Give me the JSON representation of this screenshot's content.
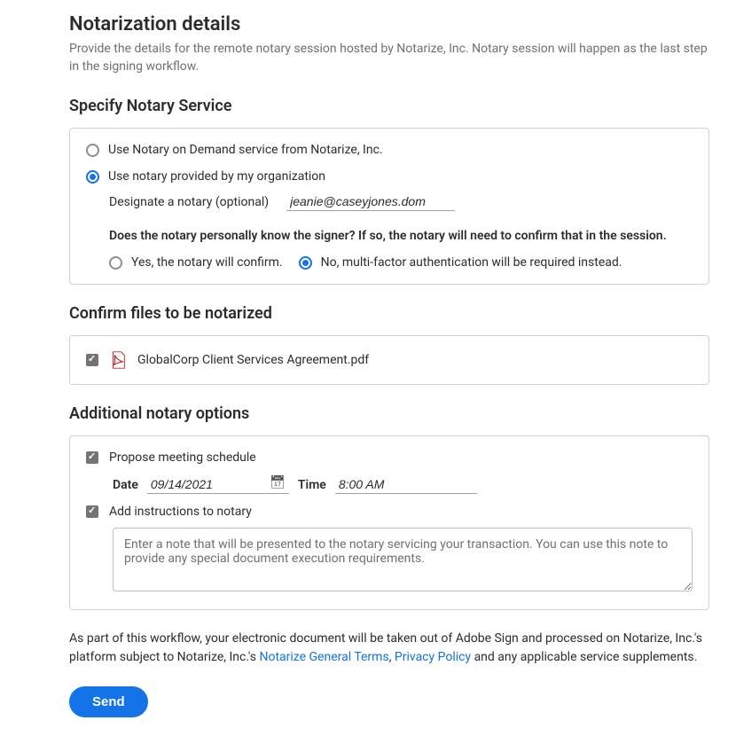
{
  "header": {
    "title": "Notarization details",
    "subtitle": "Provide the details for the remote notary session hosted by Notarize, Inc. Notary session will happen as the last step in the signing workflow."
  },
  "notaryService": {
    "heading": "Specify Notary Service",
    "option1": "Use Notary on Demand service from Notarize, Inc.",
    "option2": "Use notary provided by my organization",
    "designateLabel": "Designate a notary (optional)",
    "designateValue": "jeanie@caseyjones.dom",
    "knowQuestion": "Does the notary personally know the signer? If so, the notary will need to confirm that in the session.",
    "yesLabel": "Yes, the notary will confirm.",
    "noLabel": "No, multi-factor authentication will be required instead."
  },
  "confirmFiles": {
    "heading": "Confirm files to be notarized",
    "fileName": "GlobalCorp Client Services Agreement.pdf"
  },
  "additionalOptions": {
    "heading": "Additional notary options",
    "proposeLabel": "Propose meeting schedule",
    "dateLabel": "Date",
    "dateValue": "09/14/2021",
    "timeLabel": "Time",
    "timeValue": "8:00 AM",
    "instructionsLabel": "Add instructions to notary",
    "instructionsPlaceholder": "Enter a note that will be presented to the notary servicing your transaction. You can use this note to provide any special document execution requirements."
  },
  "footer": {
    "disclaimerPrefix": "As part of this workflow, your electronic document will be taken out of Adobe Sign and processed on Notarize, Inc.'s platform subject to Notarize, Inc.'s ",
    "link1": "Notarize General Terms",
    "comma": ", ",
    "link2": "Privacy Policy",
    "disclaimerSuffix": " and any applicable service supplements.",
    "sendLabel": "Send"
  }
}
